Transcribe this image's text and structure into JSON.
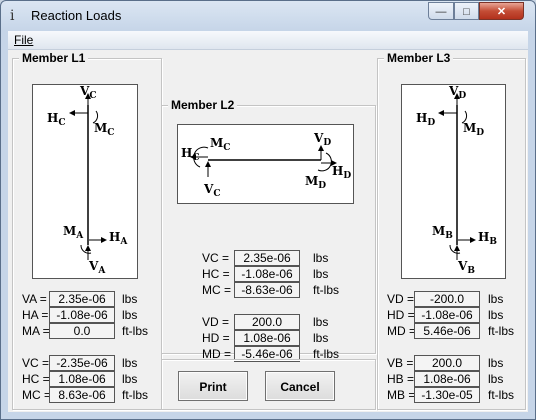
{
  "window": {
    "title": "Reaction Loads",
    "min_glyph": "—",
    "max_glyph": "□",
    "close_glyph": "✕"
  },
  "menu": {
    "file": "File"
  },
  "l1": {
    "title": "Member L1",
    "labels": {
      "VC": "VC",
      "MC": "MC",
      "HC": "HC",
      "MA": "MA",
      "HA": "HA",
      "VA": "VA"
    },
    "top_rows": [
      {
        "label": "VA =",
        "value": "2.35e-06",
        "unit": "lbs"
      },
      {
        "label": "HA =",
        "value": "-1.08e-06",
        "unit": "lbs"
      },
      {
        "label": "MA =",
        "value": "0.0",
        "unit": "ft-lbs"
      }
    ],
    "bottom_rows": [
      {
        "label": "VC =",
        "value": "-2.35e-06",
        "unit": "lbs"
      },
      {
        "label": "HC =",
        "value": "1.08e-06",
        "unit": "lbs"
      },
      {
        "label": "MC =",
        "value": "8.63e-06",
        "unit": "ft-lbs"
      }
    ]
  },
  "l2": {
    "title": "Member L2",
    "top_rows": [
      {
        "label": "VC =",
        "value": "2.35e-06",
        "unit": "lbs"
      },
      {
        "label": "HC =",
        "value": "-1.08e-06",
        "unit": "lbs"
      },
      {
        "label": "MC =",
        "value": "-8.63e-06",
        "unit": "ft-lbs"
      }
    ],
    "bottom_rows": [
      {
        "label": "VD =",
        "value": "200.0",
        "unit": "lbs"
      },
      {
        "label": "HD =",
        "value": "1.08e-06",
        "unit": "lbs"
      },
      {
        "label": "MD =",
        "value": "-5.46e-06",
        "unit": "ft-lbs"
      }
    ]
  },
  "l3": {
    "title": "Member L3",
    "top_rows": [
      {
        "label": "VD =",
        "value": "-200.0",
        "unit": "lbs"
      },
      {
        "label": "HD =",
        "value": "-1.08e-06",
        "unit": "lbs"
      },
      {
        "label": "MD =",
        "value": "5.46e-06",
        "unit": "ft-lbs"
      }
    ],
    "bottom_rows": [
      {
        "label": "VB =",
        "value": "200.0",
        "unit": "lbs"
      },
      {
        "label": "HB =",
        "value": "1.08e-06",
        "unit": "lbs"
      },
      {
        "label": "MB =",
        "value": "-1.30e-05",
        "unit": "ft-lbs"
      }
    ]
  },
  "buttons": {
    "print": "Print",
    "cancel": "Cancel"
  }
}
